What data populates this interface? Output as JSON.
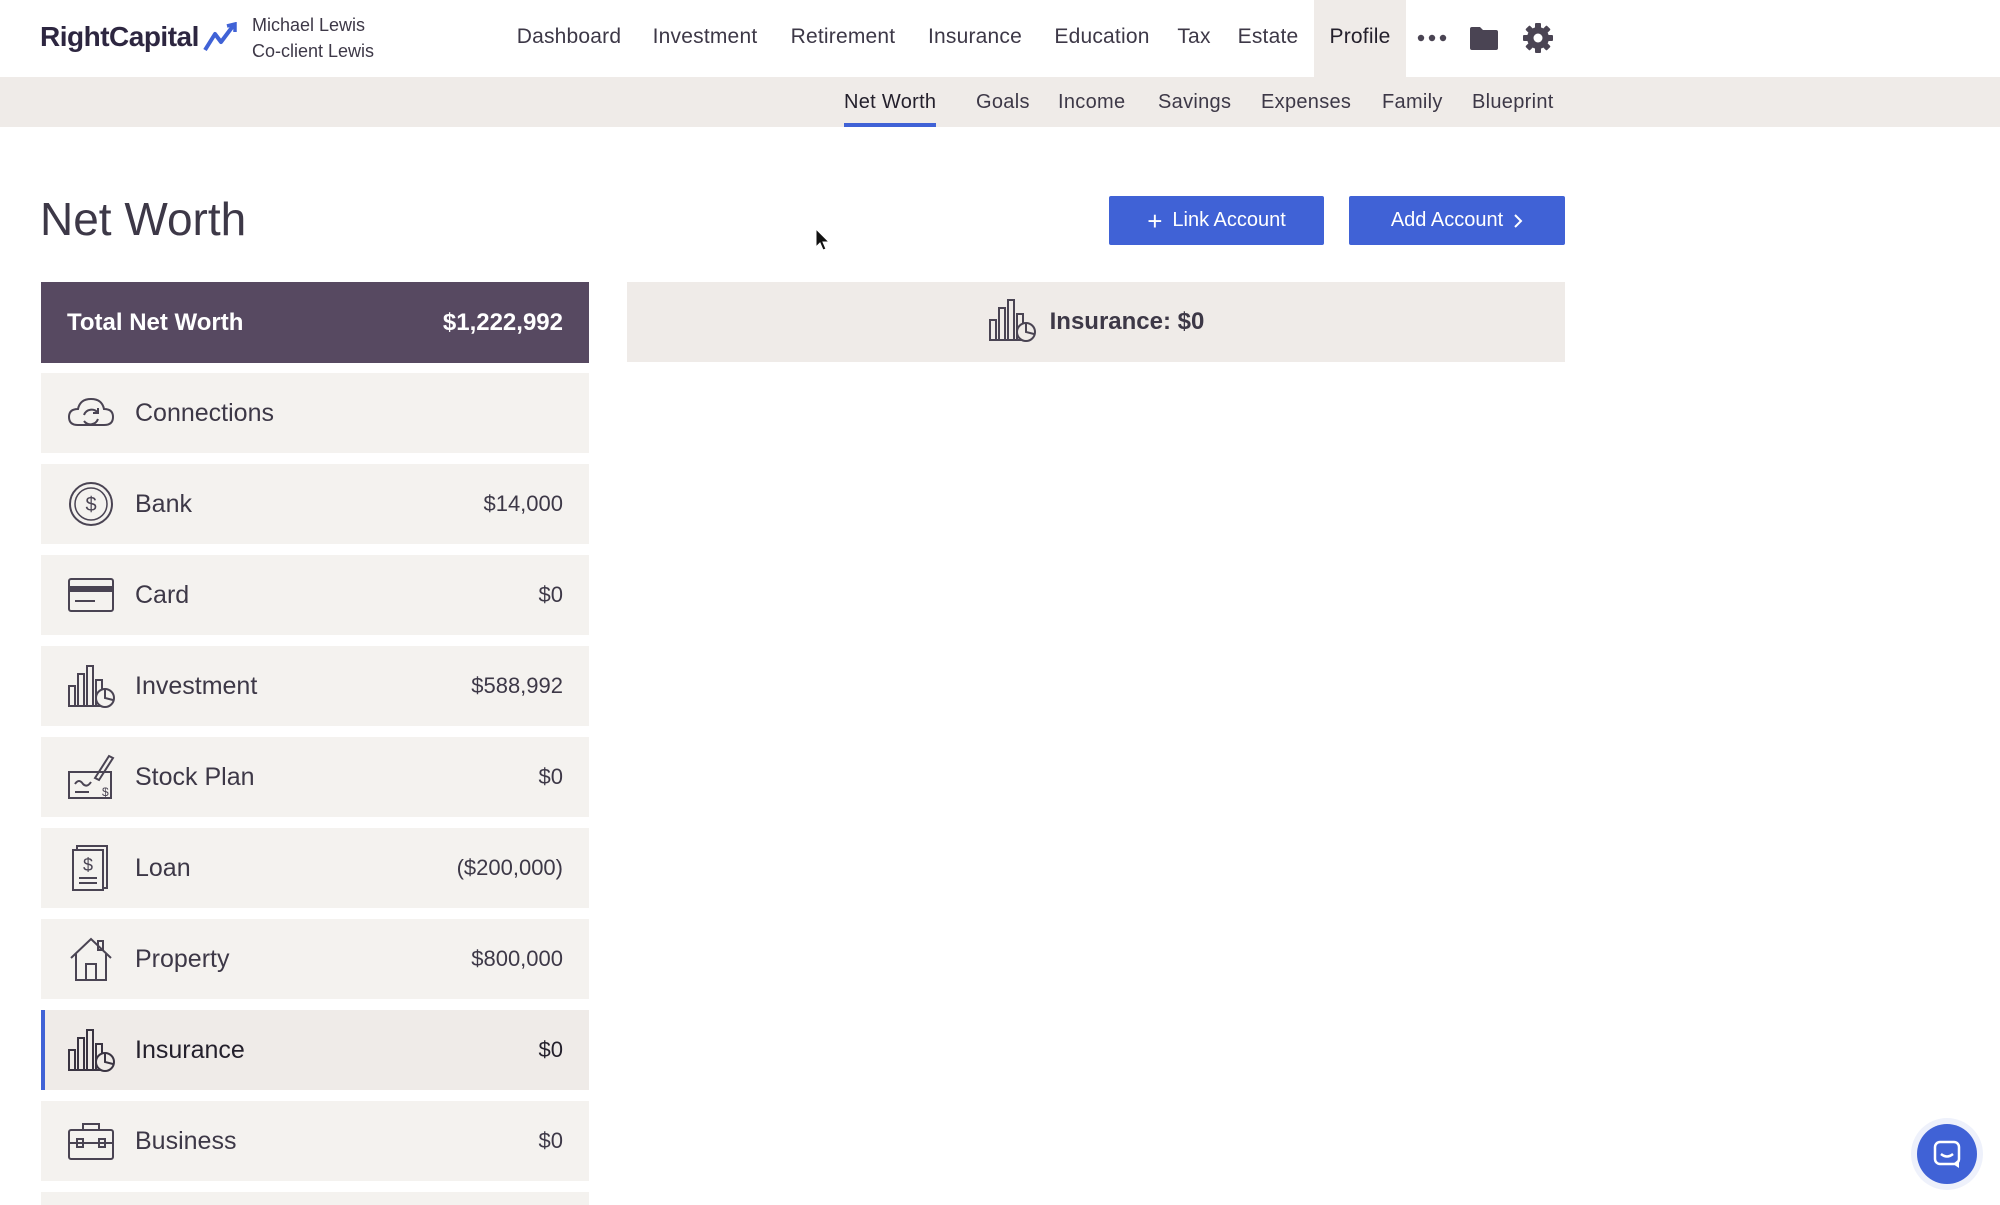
{
  "brand": {
    "name": "RightCapital"
  },
  "client": {
    "primary": "Michael Lewis",
    "secondary": "Co-client Lewis"
  },
  "main_nav": [
    {
      "label": "Dashboard"
    },
    {
      "label": "Investment"
    },
    {
      "label": "Retirement"
    },
    {
      "label": "Insurance"
    },
    {
      "label": "Education"
    },
    {
      "label": "Tax"
    },
    {
      "label": "Estate"
    },
    {
      "label": "Profile",
      "active": true
    }
  ],
  "top_icons": [
    "more-icon",
    "folder-icon",
    "gear-icon"
  ],
  "sub_nav": [
    {
      "label": "Net Worth",
      "active": true
    },
    {
      "label": "Goals"
    },
    {
      "label": "Income"
    },
    {
      "label": "Savings"
    },
    {
      "label": "Expenses"
    },
    {
      "label": "Family"
    },
    {
      "label": "Blueprint"
    }
  ],
  "page": {
    "title": "Net Worth",
    "link_account_label": "Link Account",
    "add_account_label": "Add Account"
  },
  "total": {
    "label": "Total Net Worth",
    "value": "$1,222,992"
  },
  "accounts": [
    {
      "label": "Connections",
      "value": "",
      "icon": "cloud-sync-icon"
    },
    {
      "label": "Bank",
      "value": "$14,000",
      "icon": "dollar-coin-icon"
    },
    {
      "label": "Card",
      "value": "$0",
      "icon": "credit-card-icon"
    },
    {
      "label": "Investment",
      "value": "$588,992",
      "icon": "chart-pie-icon"
    },
    {
      "label": "Stock Plan",
      "value": "$0",
      "icon": "check-sign-icon"
    },
    {
      "label": "Loan",
      "value": "($200,000)",
      "icon": "loan-document-icon"
    },
    {
      "label": "Property",
      "value": "$800,000",
      "icon": "house-icon"
    },
    {
      "label": "Insurance",
      "value": "$0",
      "icon": "chart-pie-icon",
      "active": true
    },
    {
      "label": "Business",
      "value": "$0",
      "icon": "briefcase-icon"
    }
  ],
  "detail": {
    "title": "Insurance: $0",
    "icon": "chart-pie-icon"
  },
  "colors": {
    "accent": "#4062d6",
    "total_bg": "#574961",
    "subnav_bg": "#efebe8",
    "row_bg": "#f4f2ef"
  }
}
